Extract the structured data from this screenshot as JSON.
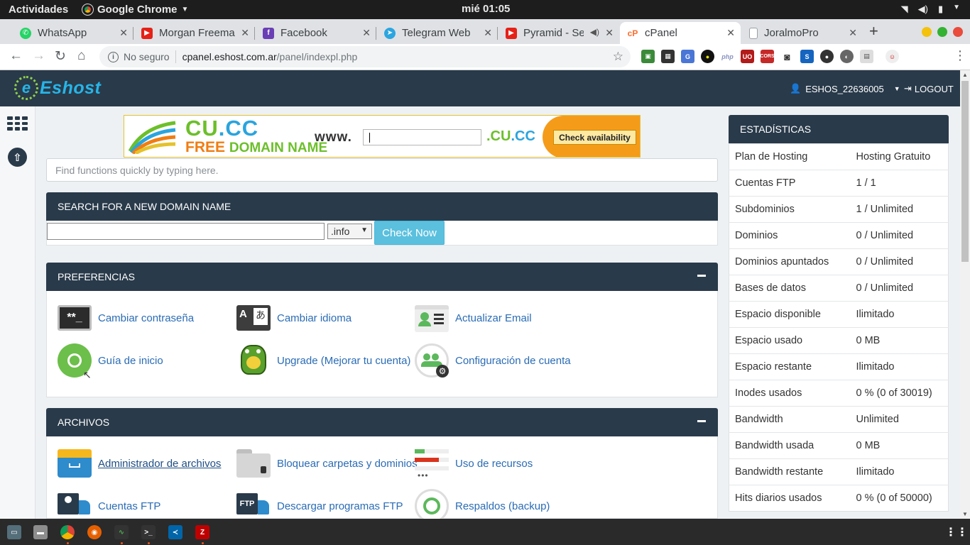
{
  "os": {
    "activities": "Actividades",
    "app_name": "Google Chrome",
    "clock": "mié 01:05"
  },
  "tabs": [
    {
      "label": "WhatsApp",
      "icon": "whatsapp-icon",
      "color": "#25d366"
    },
    {
      "label": "Morgan Freema",
      "icon": "youtube-icon",
      "color": "#e62117"
    },
    {
      "label": "Facebook",
      "icon": "facebook-icon",
      "color": "#6a3fb5"
    },
    {
      "label": "Telegram Web",
      "icon": "telegram-icon",
      "color": "#2ca5e0"
    },
    {
      "label": "Pyramid - Se",
      "icon": "youtube-icon",
      "color": "#e62117"
    },
    {
      "label": "cPanel",
      "icon": "cpanel-icon",
      "color": "#ff6c2c"
    },
    {
      "label": "JoralmoPro",
      "icon": "page-icon",
      "color": "#9aa0a6"
    }
  ],
  "addressbar": {
    "security": "No seguro",
    "host": "cpanel.eshost.com.ar",
    "path": "/panel/indexpl.php"
  },
  "header": {
    "logo_text": "Eshost",
    "logo_letter": "e",
    "username": "ESHOS_22636005",
    "logout": "LOGOUT"
  },
  "banner": {
    "brand_a": "CU",
    "brand_b": ".CC",
    "free": "FREE",
    "domain_name": "DOMAIN NAME",
    "www": "www.",
    "tld_a": ".CU",
    "tld_b": ".CC",
    "button": "Check availability"
  },
  "quickfind": {
    "placeholder": "Find functions quickly by typing here."
  },
  "domain_search": {
    "title": "SEARCH FOR A NEW DOMAIN NAME",
    "tld": ".info",
    "button": "Check Now"
  },
  "preferencias": {
    "title": "PREFERENCIAS",
    "items": [
      "Cambiar contraseña",
      "Cambiar idioma",
      "Actualizar Email",
      "Guía de inicio",
      "Upgrade (Mejorar tu cuenta)",
      "Configuración de cuenta"
    ]
  },
  "archivos": {
    "title": "ARCHIVOS",
    "items": [
      "Administrador de archivos",
      "Bloquear carpetas y dominios",
      "Uso de recursos",
      "Cuentas FTP",
      "Descargar programas FTP",
      "Respaldos (backup)"
    ]
  },
  "stats": {
    "title": "ESTADÍSTICAS",
    "rows": [
      [
        "Plan de Hosting",
        "Hosting Gratuito"
      ],
      [
        "Cuentas FTP",
        "1 / 1"
      ],
      [
        "Subdominios",
        "1 / Unlimited"
      ],
      [
        "Dominios",
        "0 / Unlimited"
      ],
      [
        "Dominios apuntados",
        "0 / Unlimited"
      ],
      [
        "Bases de datos",
        "0 / Unlimited"
      ],
      [
        "Espacio disponible",
        "Ilimitado"
      ],
      [
        "Espacio usado",
        "0 MB"
      ],
      [
        "Espacio restante",
        "Ilimitado"
      ],
      [
        "Inodes usados",
        "0 % (0 of 30019)"
      ],
      [
        "Bandwidth",
        "Unlimited"
      ],
      [
        "Bandwidth usada",
        "0 MB"
      ],
      [
        "Bandwidth restante",
        "Ilimitado"
      ],
      [
        "Hits diarios usados",
        "0 % (0 of 50000)"
      ]
    ]
  }
}
